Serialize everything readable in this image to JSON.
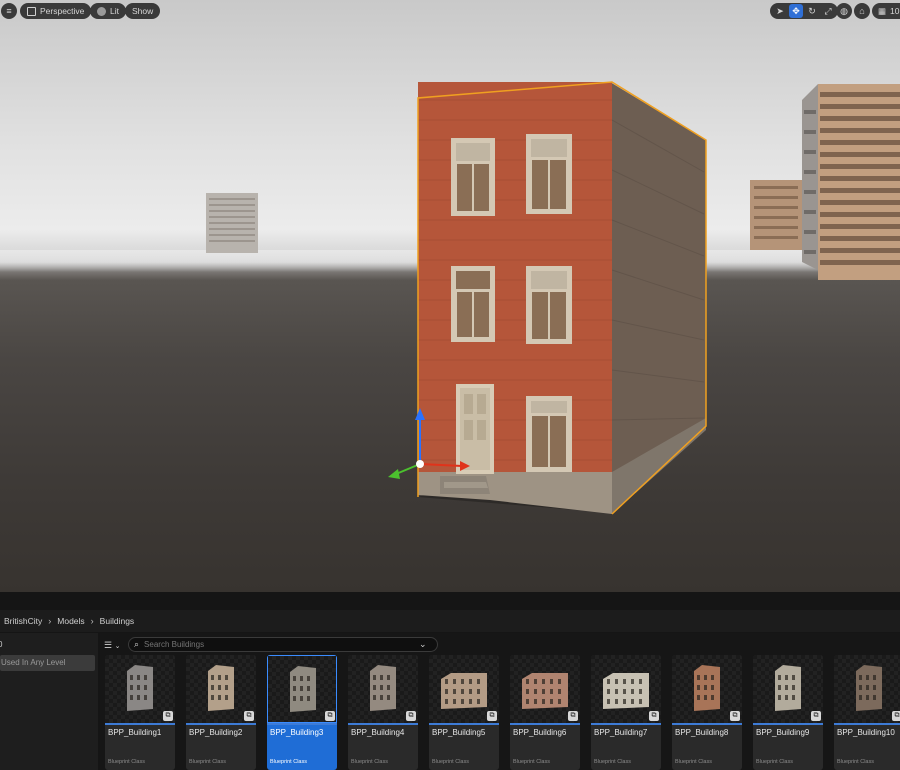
{
  "viewport": {
    "menu_icon": "hamburger-icon",
    "perspective_label": "Perspective",
    "lit_label": "Lit",
    "show_label": "Show",
    "grid_value": "10",
    "tools": [
      "select-icon",
      "move-icon",
      "rotate-icon",
      "scale-icon",
      "world-icon",
      "surface-snap-icon",
      "grid-icon"
    ],
    "active_tool": "move-icon"
  },
  "breadcrumb": {
    "items": [
      "BritishCity",
      "Models",
      "Buildings"
    ]
  },
  "left_panel": {
    "marker": "0",
    "filter_label": "Used In Any Level"
  },
  "assets": {
    "search_placeholder": "Search Buildings",
    "items": [
      {
        "name": "BPP_Building1",
        "type": "Blueprint Class"
      },
      {
        "name": "BPP_Building2",
        "type": "Blueprint Class"
      },
      {
        "name": "BPP_Building3",
        "type": "Blueprint Class"
      },
      {
        "name": "BPP_Building4",
        "type": "Blueprint Class"
      },
      {
        "name": "BPP_Building5",
        "type": "Blueprint Class"
      },
      {
        "name": "BPP_Building6",
        "type": "Blueprint Class"
      },
      {
        "name": "BPP_Building7",
        "type": "Blueprint Class"
      },
      {
        "name": "BPP_Building8",
        "type": "Blueprint Class"
      },
      {
        "name": "BPP_Building9",
        "type": "Blueprint Class"
      },
      {
        "name": "BPP_Building10",
        "type": "Blueprint Class"
      }
    ],
    "selected_index": 2
  },
  "colors": {
    "accent": "#1f6dd6",
    "selection_outline": "#f0a020",
    "brick": "#b5563a"
  }
}
